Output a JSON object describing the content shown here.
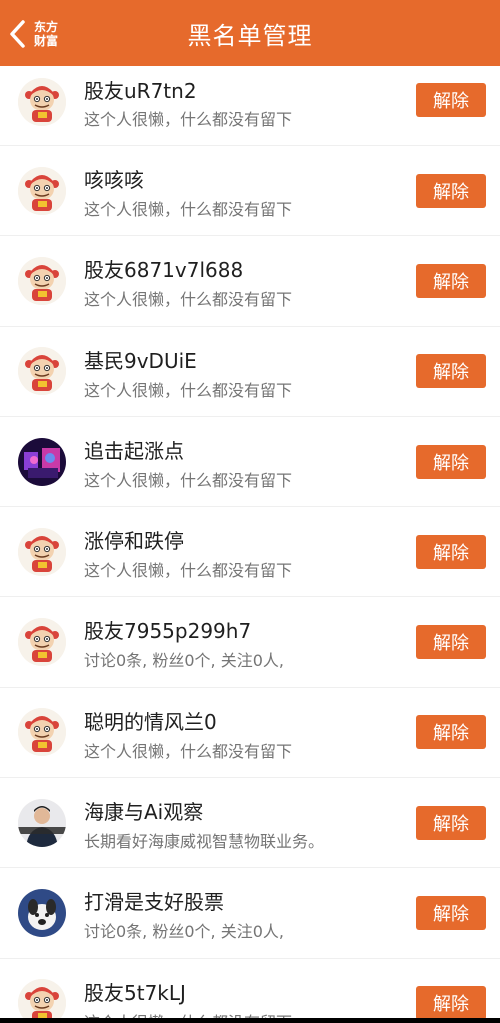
{
  "header": {
    "title": "黑名单管理",
    "brand_line1": "东方",
    "brand_line2": "财富",
    "accent": "#e66a2c"
  },
  "items": [
    {
      "name": "股友uR7tn2",
      "desc": "这个人很懒，什么都没有留下",
      "button": "解除",
      "avatar": "mascot"
    },
    {
      "name": "咳咳咳",
      "desc": "这个人很懒，什么都没有留下",
      "button": "解除",
      "avatar": "mascot"
    },
    {
      "name": "股友6871v7l688",
      "desc": "这个人很懒，什么都没有留下",
      "button": "解除",
      "avatar": "mascot"
    },
    {
      "name": "基民9vDUiE",
      "desc": "这个人很懒，什么都没有留下",
      "button": "解除",
      "avatar": "mascot"
    },
    {
      "name": "追击起涨点",
      "desc": "这个人很懒，什么都没有留下",
      "button": "解除",
      "avatar": "photo-purple"
    },
    {
      "name": "涨停和跌停",
      "desc": "这个人很懒，什么都没有留下",
      "button": "解除",
      "avatar": "mascot"
    },
    {
      "name": "股友7955p299h7",
      "desc": "讨论0条, 粉丝0个, 关注0人,",
      "button": "解除",
      "avatar": "mascot"
    },
    {
      "name": "聪明的情风兰0",
      "desc": "这个人很懒，什么都没有留下",
      "button": "解除",
      "avatar": "mascot"
    },
    {
      "name": "海康与Ai观察",
      "desc": "长期看好海康威视智慧物联业务。",
      "button": "解除",
      "avatar": "photo-person"
    },
    {
      "name": "打滑是支好股票",
      "desc": "讨论0条, 粉丝0个, 关注0人,",
      "button": "解除",
      "avatar": "photo-dog"
    },
    {
      "name": "股友5t7kLJ",
      "desc": "这个人很懒，什么都没有留下",
      "button": "解除",
      "avatar": "mascot"
    }
  ]
}
